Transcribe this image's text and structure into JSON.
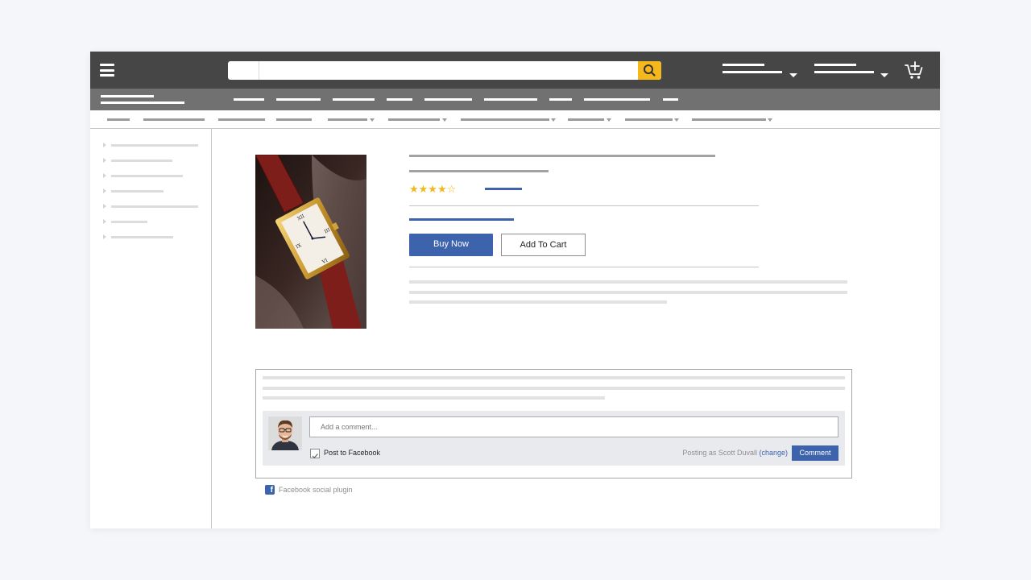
{
  "header": {
    "menu_icon": "hamburger-icon",
    "search_placeholder": "",
    "search_icon": "search-icon",
    "cart_icon": "add-to-cart-icon",
    "accent": "#f4b81d",
    "bar_color": "#464646"
  },
  "nav": {
    "bar_color": "#717171"
  },
  "product": {
    "rating_stars": "★★★★☆",
    "rating_value": 4,
    "rating_max": 5,
    "buy_now_label": "Buy Now",
    "add_to_cart_label": "Add To Cart",
    "brand_color": "#3d63ad"
  },
  "comments": {
    "input_placeholder": "Add a comment...",
    "post_to_facebook_label": "Post to Facebook",
    "post_to_facebook_checked": true,
    "posting_as_prefix": "Posting as Scott Duvall",
    "change_link": "(change)",
    "comment_button_label": "Comment",
    "plugin_label": "Facebook social plugin",
    "plugin_icon": "facebook-icon"
  }
}
